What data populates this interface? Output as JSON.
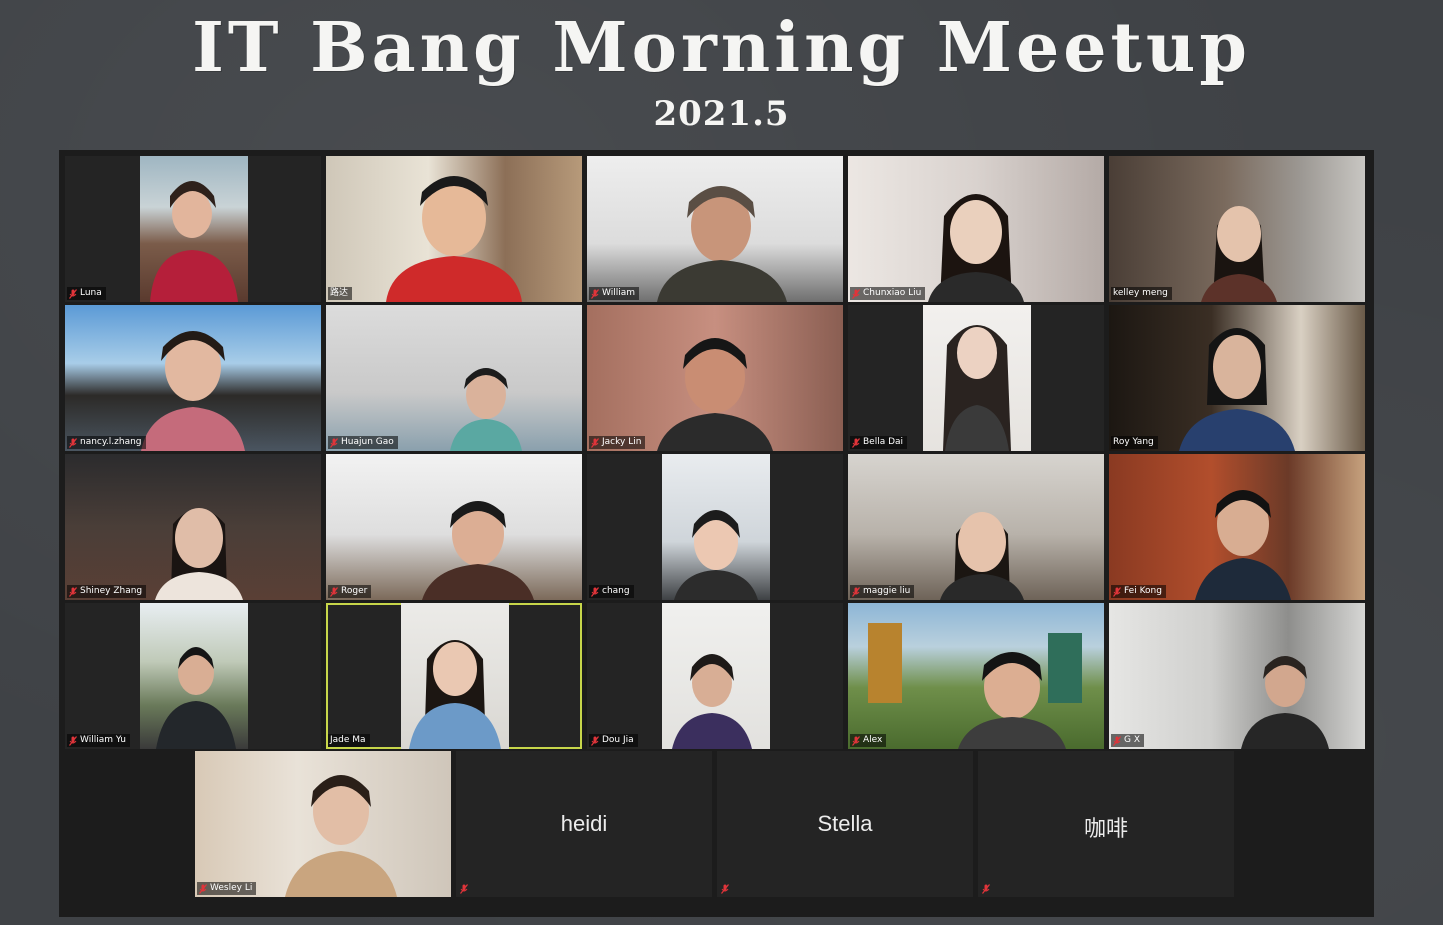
{
  "banner": {
    "title": "IT Bang Morning Meetup",
    "subtitle": "2021.5"
  },
  "gallery": {
    "participants": [
      {
        "name": "Luna",
        "muted": true
      },
      {
        "name": "路达",
        "muted": false
      },
      {
        "name": "William",
        "muted": true
      },
      {
        "name": "Chunxiao Liu",
        "muted": true
      },
      {
        "name": "kelley meng",
        "muted": false
      },
      {
        "name": "nancy.l.zhang",
        "muted": true
      },
      {
        "name": "Huajun Gao",
        "muted": true
      },
      {
        "name": "Jacky Lin",
        "muted": true
      },
      {
        "name": "Bella Dai",
        "muted": true
      },
      {
        "name": "Roy Yang",
        "muted": false
      },
      {
        "name": "Shiney Zhang",
        "muted": true
      },
      {
        "name": "Roger",
        "muted": true
      },
      {
        "name": "chang",
        "muted": true
      },
      {
        "name": "maggie liu",
        "muted": true
      },
      {
        "name": "Fei Kong",
        "muted": true
      },
      {
        "name": "William Yu",
        "muted": true
      },
      {
        "name": "Jade Ma",
        "muted": false,
        "active_speaker": true
      },
      {
        "name": "Dou Jia",
        "muted": true
      },
      {
        "name": "Alex",
        "muted": true
      },
      {
        "name": "G X",
        "muted": true
      },
      {
        "name": "Wesley Li",
        "muted": true
      },
      {
        "name": "heidi",
        "muted": true,
        "video_off": true
      },
      {
        "name": "Stella",
        "muted": true,
        "video_off": true
      },
      {
        "name": "咖啡",
        "muted": true,
        "video_off": true
      }
    ]
  },
  "colors": {
    "chalkboard": "#3f4246",
    "gallery_bg": "#1c1c1c",
    "active_speaker_border": "#c7d64a",
    "muted_icon": "#e0343a"
  }
}
